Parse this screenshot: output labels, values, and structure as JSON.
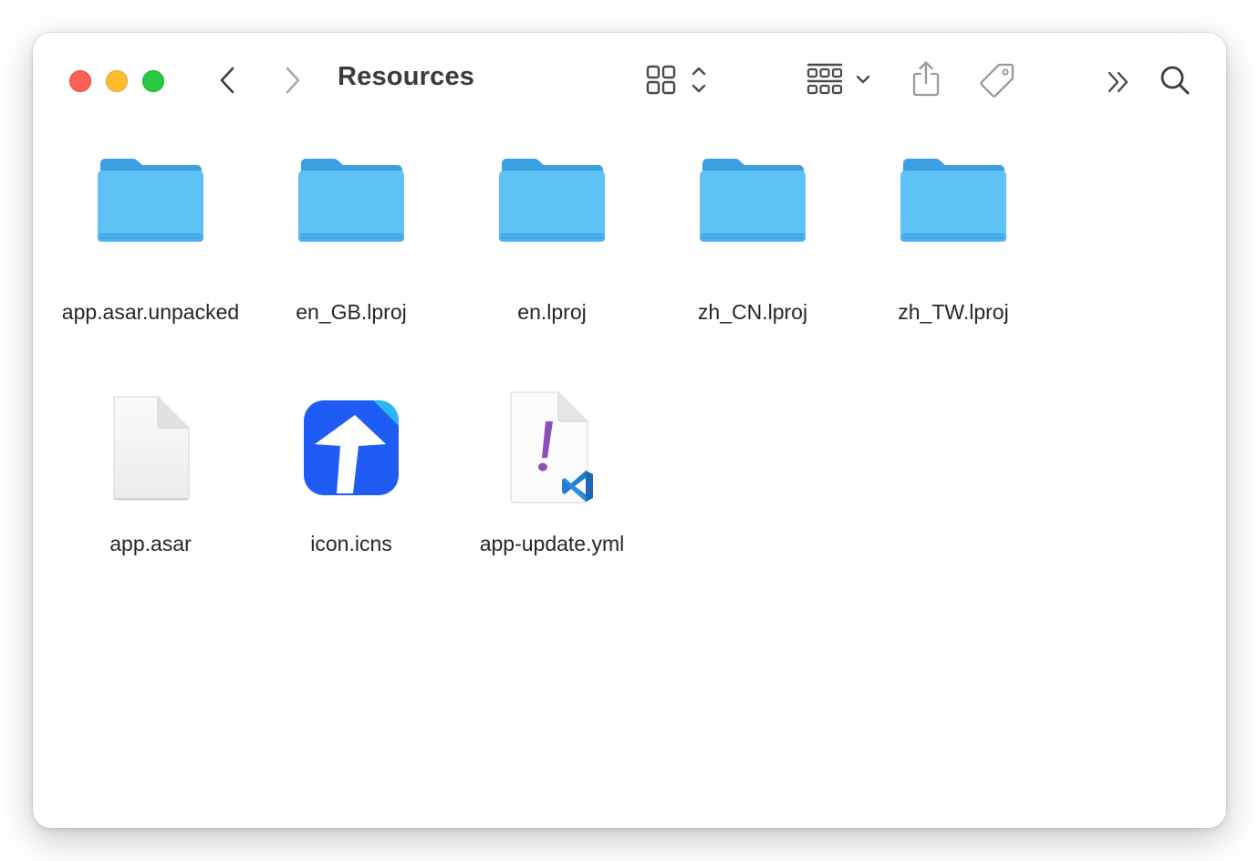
{
  "window": {
    "title": "Resources"
  },
  "toolbar": {
    "traffic_lights": [
      {
        "name": "close",
        "color": "#fe5f57"
      },
      {
        "name": "minimize",
        "color": "#febc2e"
      },
      {
        "name": "zoom",
        "color": "#28c840"
      }
    ],
    "icons": [
      "back-icon",
      "forward-icon",
      "icon-view-icon",
      "group-icon",
      "share-icon",
      "tag-icon",
      "more-icon",
      "search-icon"
    ]
  },
  "files": [
    {
      "name": "app.asar.unpacked",
      "kind": "folder"
    },
    {
      "name": "en_GB.lproj",
      "kind": "folder"
    },
    {
      "name": "en.lproj",
      "kind": "folder"
    },
    {
      "name": "zh_CN.lproj",
      "kind": "folder"
    },
    {
      "name": "zh_TW.lproj",
      "kind": "folder"
    },
    {
      "name": "app.asar",
      "kind": "document"
    },
    {
      "name": "icon.icns",
      "kind": "icns"
    },
    {
      "name": "app-update.yml",
      "kind": "yaml"
    }
  ],
  "colors": {
    "folder_body": "#5ec2f7",
    "folder_tab": "#3a9fe3",
    "icns_blue": "#1f5bf5",
    "yaml_mark": "#8c4fb5",
    "vscode_blue": "#1f7fd6"
  }
}
